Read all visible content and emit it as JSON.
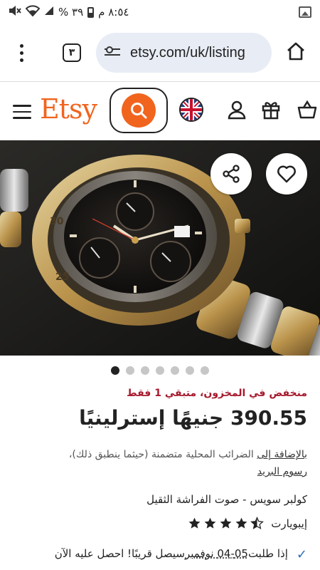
{
  "status_bar": {
    "time": "٨:٥٤ م",
    "battery": "٣٩ %"
  },
  "browser": {
    "tab_count": "٣",
    "url": "etsy.com/uk/listing"
  },
  "etsy_header": {
    "logo": "Etsy"
  },
  "gallery": {
    "dot_count": 7,
    "active_index": 0
  },
  "product": {
    "stock_text": "منخفض في المخزون، متبقي 1 فقط",
    "price": "390.55 جنيهًا إسترلينيًا",
    "tax_prefix": "بالإضافة إلى",
    "tax_middle": "الضرائب المحلية متضمنة (حيثما ينطبق ذلك)،",
    "tax_link": "رسوم البريد",
    "title": "كولبر سويس - صوت الفراشة الثقيل",
    "shop_name": "إيبويارت",
    "rating": 4.5,
    "delivery_text": "إذا طلبت",
    "delivery_dates": "05-04 نوفمبر",
    "delivery_rest": "سيصل قريبًا! احصل عليه الآن"
  },
  "colors": {
    "accent": "#f1641e",
    "stock_red": "#a61a2e",
    "check_blue": "#2a6ebb"
  }
}
